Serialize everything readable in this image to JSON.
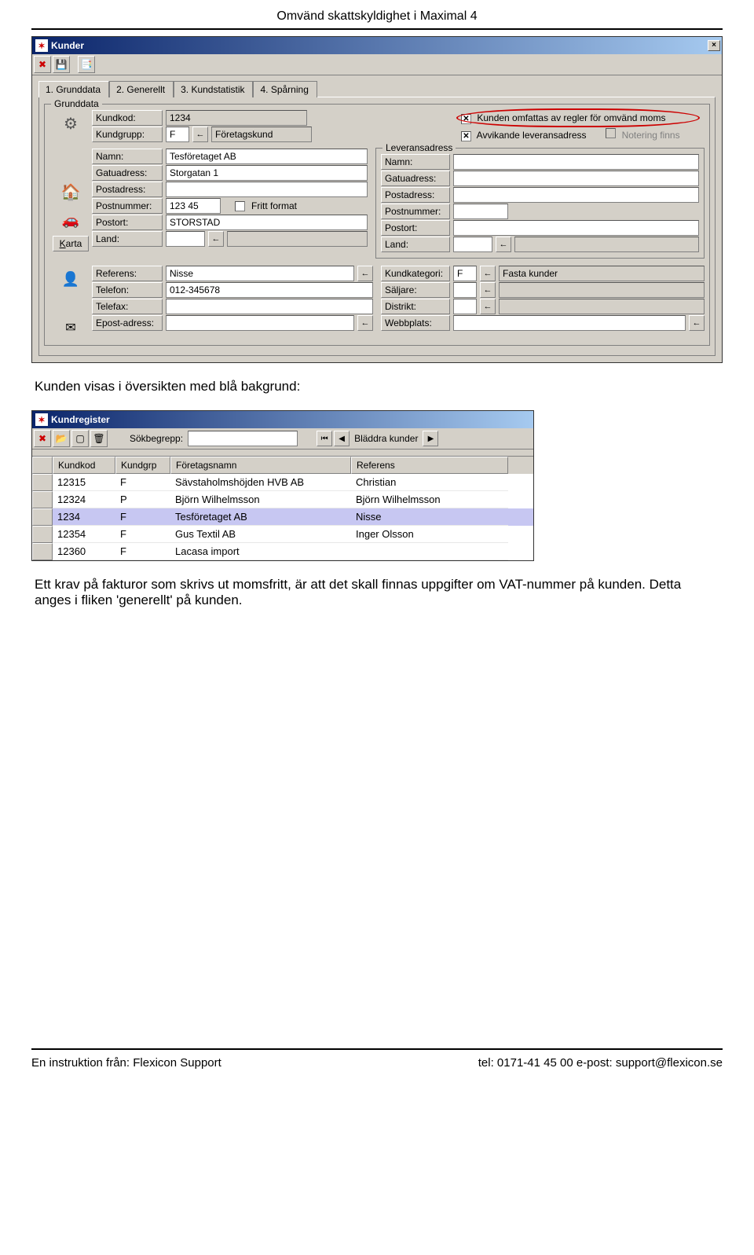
{
  "doc_title": "Omvänd skattskyldighet i Maximal 4",
  "window1": {
    "title": "Kunder",
    "tabs": [
      "1. Grunddata",
      "2. Generellt",
      "3. Kundstatistik",
      "4. Spårning"
    ],
    "group_title": "Grunddata",
    "kundkod_lbl": "Kundkod:",
    "kundkod_val": "1234",
    "kundgrupp_lbl": "Kundgrupp:",
    "kundgrupp_val": "F",
    "kundgrupp_desc": "Företagskund",
    "cb_omvand": "Kunden omfattas av regler för omvänd moms",
    "cb_avvik": "Avvikande leveransadress",
    "cb_notering": "Notering finns",
    "namn_lbl": "Namn:",
    "namn_val": "Tesföretaget AB",
    "gatu_lbl": "Gatuadress:",
    "gatu_val": "Storgatan 1",
    "post_lbl": "Postadress:",
    "post_val": "",
    "postnr_lbl": "Postnummer:",
    "postnr_val": "123 45",
    "fritt_lbl": "Fritt format",
    "postort_lbl": "Postort:",
    "postort_val": "STORSTAD",
    "land_lbl": "Land:",
    "karta_lbl": "Karta",
    "lev_group": "Leveransadress",
    "referens_lbl": "Referens:",
    "referens_val": "Nisse",
    "tel_lbl": "Telefon:",
    "tel_val": "012-345678",
    "fax_lbl": "Telefax:",
    "epost_lbl": "Epost-adress:",
    "kundkat_lbl": "Kundkategori:",
    "kundkat_val": "F",
    "kundkat_desc": "Fasta kunder",
    "saljare_lbl": "Säljare:",
    "distrikt_lbl": "Distrikt:",
    "webb_lbl": "Webbplats:"
  },
  "body_text_1": "Kunden visas i översikten med blå bakgrund:",
  "window2": {
    "title": "Kundregister",
    "search_lbl": "Sökbegrepp:",
    "nav_label": "Bläddra kunder",
    "cols": [
      "Kundkod",
      "Kundgrp",
      "Företagsnamn",
      "Referens"
    ],
    "rows": [
      {
        "kod": "12315",
        "grp": "F",
        "namn": "Sävstaholmshöjden HVB AB",
        "ref": "Christian",
        "sel": false
      },
      {
        "kod": "12324",
        "grp": "P",
        "namn": "Björn Wilhelmsson",
        "ref": "Björn Wilhelmsson",
        "sel": false
      },
      {
        "kod": "1234",
        "grp": "F",
        "namn": "Tesföretaget AB",
        "ref": "Nisse",
        "sel": true
      },
      {
        "kod": "12354",
        "grp": "F",
        "namn": "Gus Textil AB",
        "ref": "Inger Olsson",
        "sel": false
      },
      {
        "kod": "12360",
        "grp": "F",
        "namn": "Lacasa import",
        "ref": "",
        "sel": false
      }
    ]
  },
  "body_text_2": "Ett krav på fakturor som skrivs ut momsfritt, är att det skall finnas uppgifter om VAT-nummer på kunden. Detta anges i fliken 'generellt' på kunden.",
  "footer_left": "En instruktion från: Flexicon Support",
  "footer_right": "tel: 0171-41 45 00  e-post: support@flexicon.se"
}
